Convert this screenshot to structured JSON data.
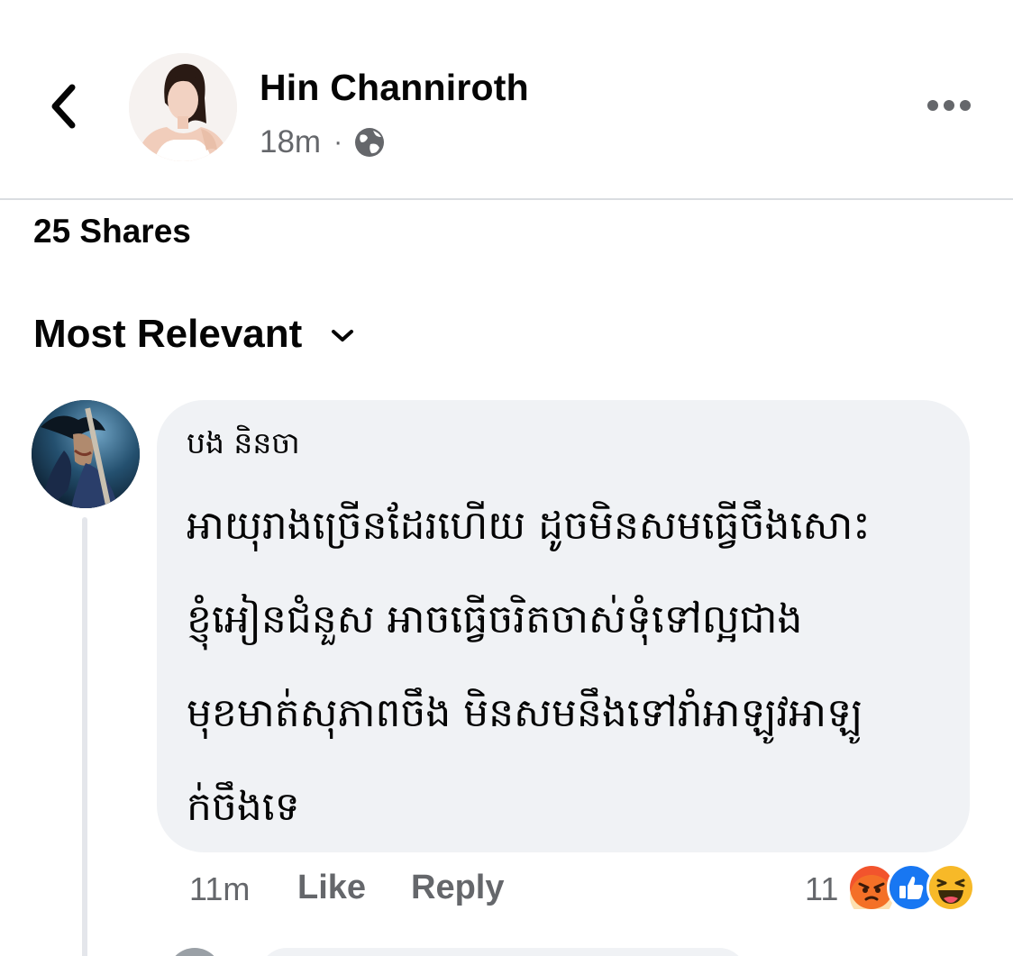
{
  "header": {
    "poster_name": "Hin Channiroth",
    "time": "18m",
    "separator": "·",
    "privacy_icon": "globe-icon",
    "back_icon": "chevron-left-icon",
    "more_icon": "more-horizontal-icon"
  },
  "shares_label": "25 Shares",
  "sort": {
    "label": "Most Relevant",
    "icon": "chevron-down-icon"
  },
  "comment": {
    "author": "បង និនចា",
    "lines": [
      "អាយុរាងច្រើនដែរហើយ ដូចមិនសមធ្វើចឹងសោះ",
      "ខ្ញុំអៀនជំនួស អាចធ្វើចរិតចាស់ទុំទៅល្អជាង",
      "មុខមាត់សុភាពចឹង មិនសមនឹងទៅរាំអាឡូវអាឡូ",
      "ក់ចឹងទេ"
    ],
    "time": "11m",
    "like_label": "Like",
    "reply_label": "Reply",
    "reaction_count": "11",
    "reactions": [
      "angry-icon",
      "like-icon",
      "haha-icon"
    ],
    "colors": {
      "angry": "#f2542d",
      "like": "#1877f2",
      "haha": "#f7b928"
    }
  },
  "colors": {
    "bubble_bg": "#f0f2f5",
    "secondary_text": "#65676b",
    "divider": "#dadde1"
  }
}
